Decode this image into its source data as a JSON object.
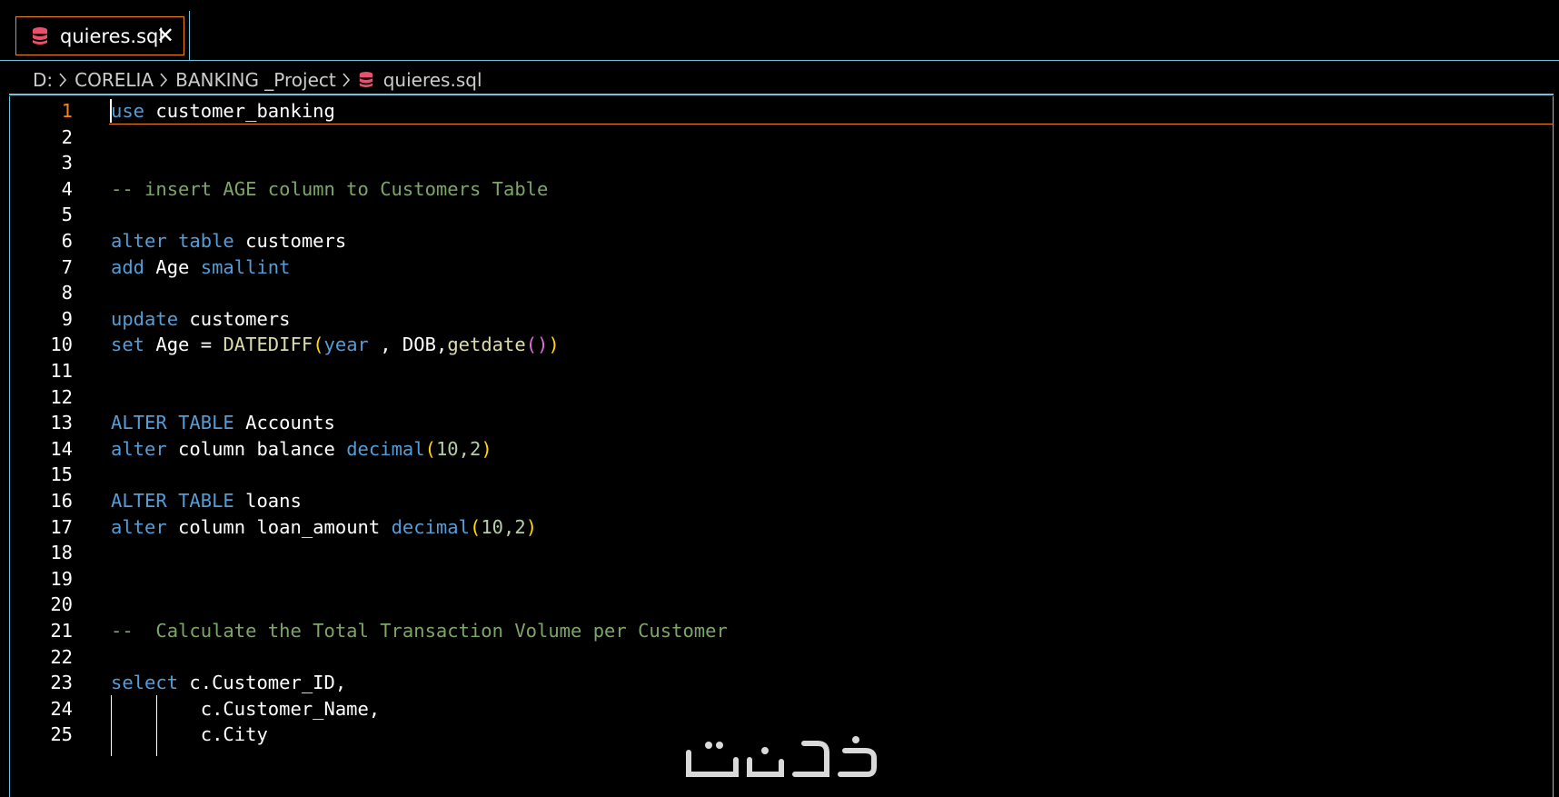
{
  "tab": {
    "label": "quieres.sql",
    "close_glyph": "✕",
    "icon": "database-icon"
  },
  "breadcrumb": {
    "items": [
      "D:",
      "CORELIA",
      "BANKING _Project"
    ],
    "file": "quieres.sql",
    "separator_icon": "chevron-right-icon",
    "file_icon": "database-icon"
  },
  "editor": {
    "active_line": 1,
    "lines": [
      {
        "n": "1",
        "tokens": [
          {
            "t": "use",
            "c": "kw"
          },
          {
            "t": " customer_banking",
            "c": ""
          }
        ]
      },
      {
        "n": "2",
        "tokens": []
      },
      {
        "n": "3",
        "tokens": []
      },
      {
        "n": "4",
        "tokens": [
          {
            "t": "-- insert AGE column to Customers Table",
            "c": "cm"
          }
        ]
      },
      {
        "n": "5",
        "tokens": []
      },
      {
        "n": "6",
        "tokens": [
          {
            "t": "alter",
            "c": "kw"
          },
          {
            "t": " ",
            "c": ""
          },
          {
            "t": "table",
            "c": "kw"
          },
          {
            "t": " customers",
            "c": ""
          }
        ]
      },
      {
        "n": "7",
        "tokens": [
          {
            "t": "add",
            "c": "kw"
          },
          {
            "t": " Age ",
            "c": ""
          },
          {
            "t": "smallint",
            "c": "kw"
          }
        ]
      },
      {
        "n": "8",
        "tokens": []
      },
      {
        "n": "9",
        "tokens": [
          {
            "t": "update",
            "c": "kw"
          },
          {
            "t": " customers",
            "c": ""
          }
        ]
      },
      {
        "n": "10",
        "tokens": [
          {
            "t": "set",
            "c": "kw"
          },
          {
            "t": " Age = ",
            "c": ""
          },
          {
            "t": "DATEDIFF",
            "c": "fn"
          },
          {
            "t": "(",
            "c": "br1"
          },
          {
            "t": "year",
            "c": "kw"
          },
          {
            "t": " , DOB,",
            "c": ""
          },
          {
            "t": "getdate",
            "c": "fn"
          },
          {
            "t": "()",
            "c": "br2"
          },
          {
            "t": ")",
            "c": "br1"
          }
        ]
      },
      {
        "n": "11",
        "tokens": []
      },
      {
        "n": "12",
        "tokens": []
      },
      {
        "n": "13",
        "tokens": [
          {
            "t": "ALTER",
            "c": "kw"
          },
          {
            "t": " ",
            "c": ""
          },
          {
            "t": "TABLE",
            "c": "kw"
          },
          {
            "t": " Accounts",
            "c": ""
          }
        ]
      },
      {
        "n": "14",
        "tokens": [
          {
            "t": "alter",
            "c": "kw"
          },
          {
            "t": " column balance ",
            "c": ""
          },
          {
            "t": "decimal",
            "c": "kw"
          },
          {
            "t": "(",
            "c": "br1"
          },
          {
            "t": "10,2",
            "c": "num"
          },
          {
            "t": ")",
            "c": "br1"
          }
        ]
      },
      {
        "n": "15",
        "tokens": []
      },
      {
        "n": "16",
        "tokens": [
          {
            "t": "ALTER",
            "c": "kw"
          },
          {
            "t": " ",
            "c": ""
          },
          {
            "t": "TABLE",
            "c": "kw"
          },
          {
            "t": " loans",
            "c": ""
          }
        ]
      },
      {
        "n": "17",
        "tokens": [
          {
            "t": "alter",
            "c": "kw"
          },
          {
            "t": " column loan_amount ",
            "c": ""
          },
          {
            "t": "decimal",
            "c": "kw"
          },
          {
            "t": "(",
            "c": "br1"
          },
          {
            "t": "10,2",
            "c": "num"
          },
          {
            "t": ")",
            "c": "br1"
          }
        ]
      },
      {
        "n": "18",
        "tokens": []
      },
      {
        "n": "19",
        "tokens": []
      },
      {
        "n": "20",
        "tokens": []
      },
      {
        "n": "21",
        "tokens": [
          {
            "t": "--  Calculate the Total Transaction Volume per Customer",
            "c": "cm"
          }
        ]
      },
      {
        "n": "22",
        "tokens": []
      },
      {
        "n": "23",
        "tokens": [
          {
            "t": "select",
            "c": "kw"
          },
          {
            "t": " c.Customer_ID,",
            "c": ""
          }
        ]
      },
      {
        "n": "24",
        "tokens": [
          {
            "t": "        c.Customer_Name,",
            "c": ""
          }
        ]
      },
      {
        "n": "25",
        "tokens": [
          {
            "t": "        c.City",
            "c": ""
          }
        ]
      }
    ]
  },
  "colors": {
    "accent_border": "#6fc3df",
    "active_orange": "#f38518",
    "keyword": "#569cd6",
    "comment": "#7ca668",
    "function": "#dcdcaa",
    "bracket_gold": "#ffd700",
    "bracket_purple": "#da70d6",
    "icon_red": "#e8506e"
  },
  "watermark": {
    "icon": "logo-watermark"
  }
}
